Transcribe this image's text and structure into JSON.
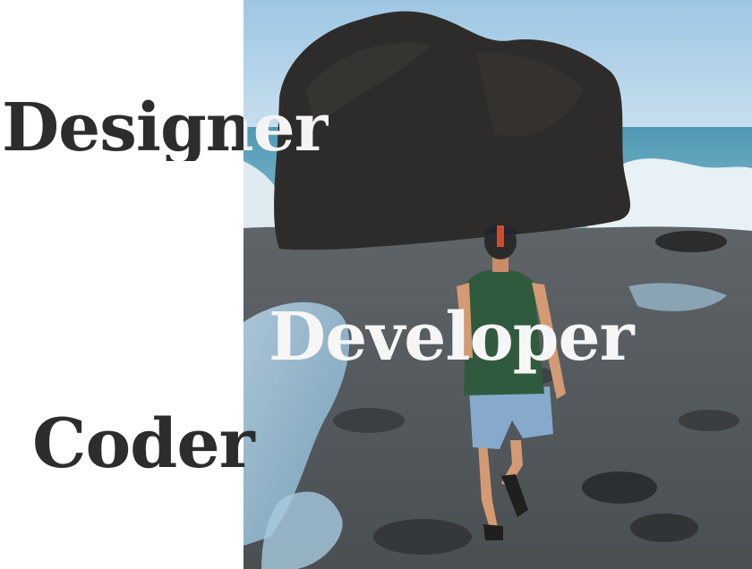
{
  "hero": {
    "words": {
      "first": "Designer",
      "second": "Developer",
      "third": "Coder"
    },
    "photo": {
      "subject": "person-walking-on-rocky-shore-icon"
    },
    "colors": {
      "text_dark": "#2d2d2d",
      "text_light": "#f6f6f6",
      "panel": "#ffffff",
      "sky": "#a9cde6",
      "sea": "#5b9fb8",
      "rock": "#2a2a2a",
      "tank_top": "#2f5a3e",
      "shorts": "#86a9cc"
    }
  }
}
